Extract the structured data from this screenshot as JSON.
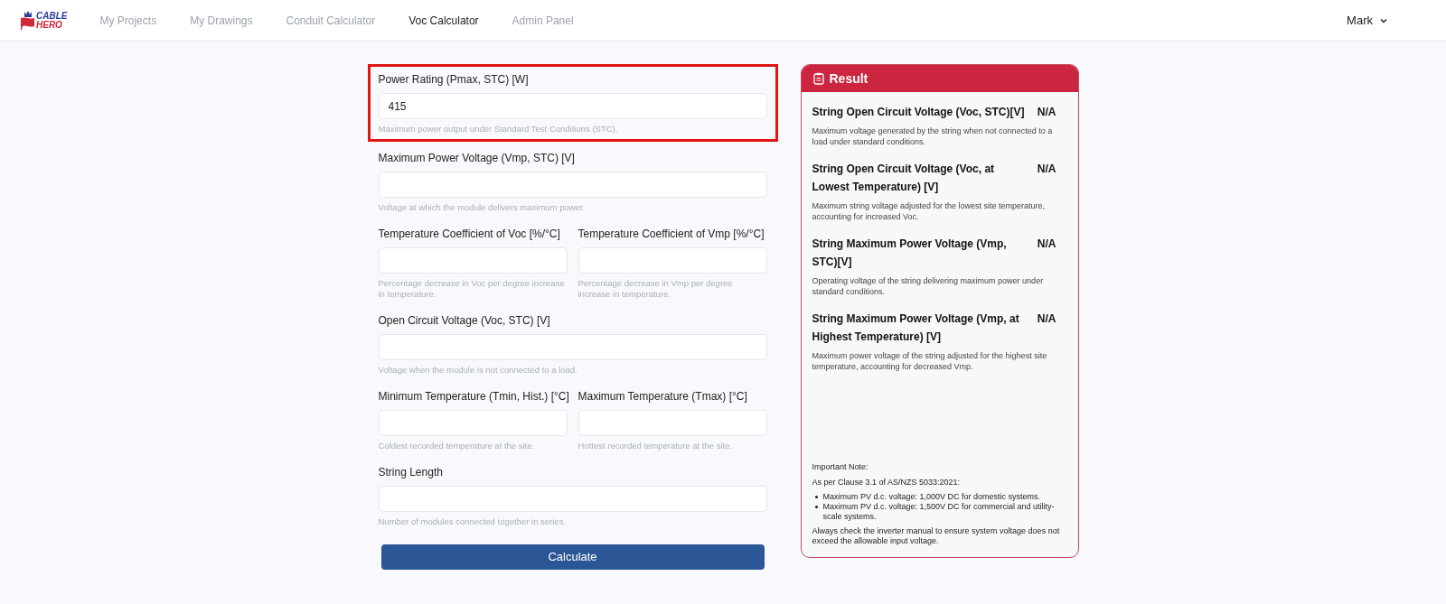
{
  "nav": {
    "logo": {
      "line1": "CABLE",
      "line2": "HERO"
    },
    "items": [
      {
        "label": "My Projects",
        "selected": false
      },
      {
        "label": "My Drawings",
        "selected": false
      },
      {
        "label": "Conduit Calculator",
        "selected": false
      },
      {
        "label": "Voc Calculator",
        "selected": true
      },
      {
        "label": "Admin Panel",
        "selected": false
      }
    ],
    "user": "Mark"
  },
  "form": {
    "rows": [
      {
        "fields": [
          {
            "label": "Power Rating (Pmax, STC) [W]",
            "value": "415",
            "help": "Maximum power output under Standard Test Conditions (STC).",
            "highlighted": true
          }
        ]
      },
      {
        "fields": [
          {
            "label": "Maximum Power Voltage (Vmp, STC) [V]",
            "help": "Voltage at which the module delivers maximum power.",
            "highlighted": false
          }
        ]
      },
      {
        "fields": [
          {
            "label": "Temperature Coefficient of Voc [%/°C]",
            "help": "Percentage decrease in Voc per degree increase in temperature.",
            "highlighted": false
          },
          {
            "label": "Temperature Coefficient of Vmp [%/°C]",
            "help": "Percentage decrease in Vmp per degree increase in temperature.",
            "highlighted": false
          }
        ]
      },
      {
        "fields": [
          {
            "label": "Open Circuit Voltage (Voc, STC) [V]",
            "help": "Voltage when the module is not connected to a load.",
            "highlighted": false
          }
        ]
      },
      {
        "fields": [
          {
            "label": "Minimum Temperature (Tmin, Hist.) [°C]",
            "help": "Coldest recorded temperature at the site.",
            "highlighted": false
          },
          {
            "label": "Maximum Temperature (Tmax) [°C]",
            "help": "Hottest recorded temperature at the site.",
            "highlighted": false
          }
        ]
      },
      {
        "fields": [
          {
            "label": "String Length",
            "help": "Number of modules connected together in series.",
            "highlighted": false
          }
        ]
      }
    ],
    "button": "Calculate"
  },
  "result": {
    "title": "Result",
    "items": [
      {
        "label": "String Open Circuit Voltage (Voc, STC)[V]",
        "value": "N/A",
        "description": "Maximum voltage generated by the string when not connected to a load under standard conditions."
      },
      {
        "label": "String Open Circuit Voltage (Voc, at Lowest Temperature) [V]",
        "value": "N/A",
        "description": "Maximum string voltage adjusted for the lowest site temperature, accounting for increased Voc."
      },
      {
        "label": "String Maximum Power Voltage (Vmp, STC)[V]",
        "value": "N/A",
        "description": "Operating voltage of the string delivering maximum power under standard conditions."
      },
      {
        "label": "String Maximum Power Voltage (Vmp, at Highest Temperature) [V]",
        "value": "N/A",
        "description": "Maximum power voltage of the string adjusted for the highest site temperature, accounting for decreased Vmp."
      }
    ],
    "note": {
      "title": "Important Note:",
      "intro": "As per Clause 3.1 of AS/NZS 5033:2021:",
      "bullets": [
        "Maximum PV d.c. voltage: 1,000V DC for domestic systems.",
        "Maximum PV d.c. voltage: 1,500V DC for commercial and utility-scale systems."
      ],
      "footer": "Always check the inverter manual to ensure system voltage does not exceed the allowable input voltage."
    }
  }
}
